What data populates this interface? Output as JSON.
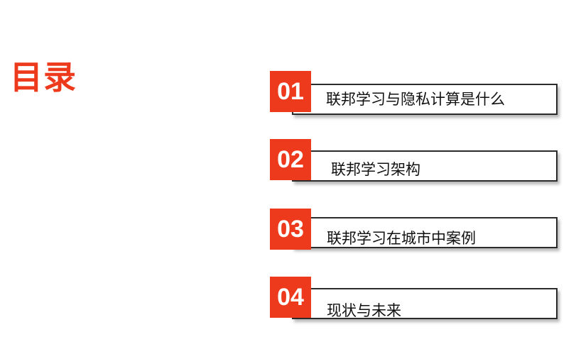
{
  "title": "目录",
  "colors": {
    "accent": "#ee3a1c",
    "border": "#2b2b2b",
    "text": "#111111"
  },
  "items": [
    {
      "number": "01",
      "label": "联邦学习与隐私计算是什么"
    },
    {
      "number": "02",
      "label": "联邦学习架构"
    },
    {
      "number": "03",
      "label": "联邦学习在城市中案例"
    },
    {
      "number": "04",
      "label": "现状与未来"
    }
  ]
}
